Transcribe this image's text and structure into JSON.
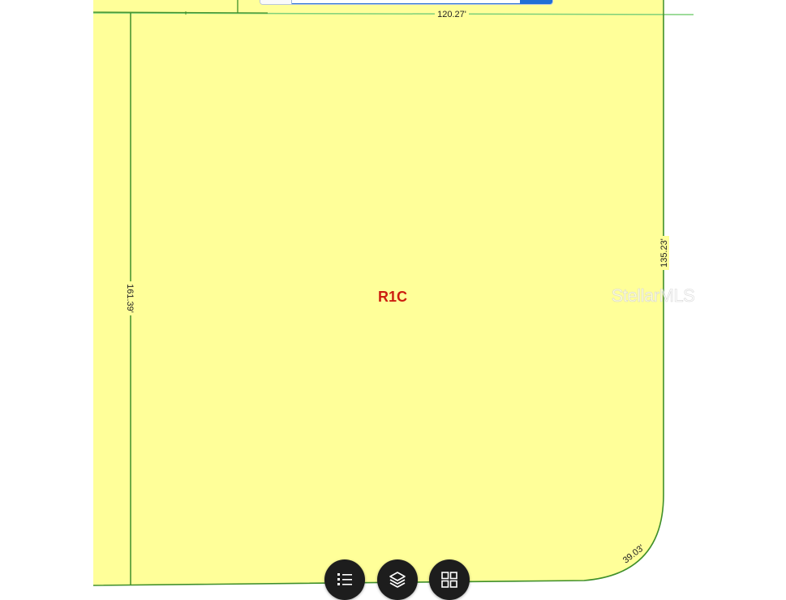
{
  "map": {
    "zone_label": "R1C",
    "dimensions": {
      "top": "120.27'",
      "left": "161.39'",
      "right": "135.23'",
      "corner": "39.03'"
    },
    "watermark": "StellarMLS",
    "colors": {
      "parcel_fill": "#ffff99",
      "parcel_line": "#3f8f2a",
      "road_line": "#7ed07a",
      "zone_text": "#cc1f10"
    }
  },
  "controls": {
    "search_bar": {
      "value": "",
      "placeholder": ""
    },
    "buttons": [
      {
        "icon": "list-icon"
      },
      {
        "icon": "layers-icon"
      },
      {
        "icon": "grid-icon"
      }
    ]
  }
}
